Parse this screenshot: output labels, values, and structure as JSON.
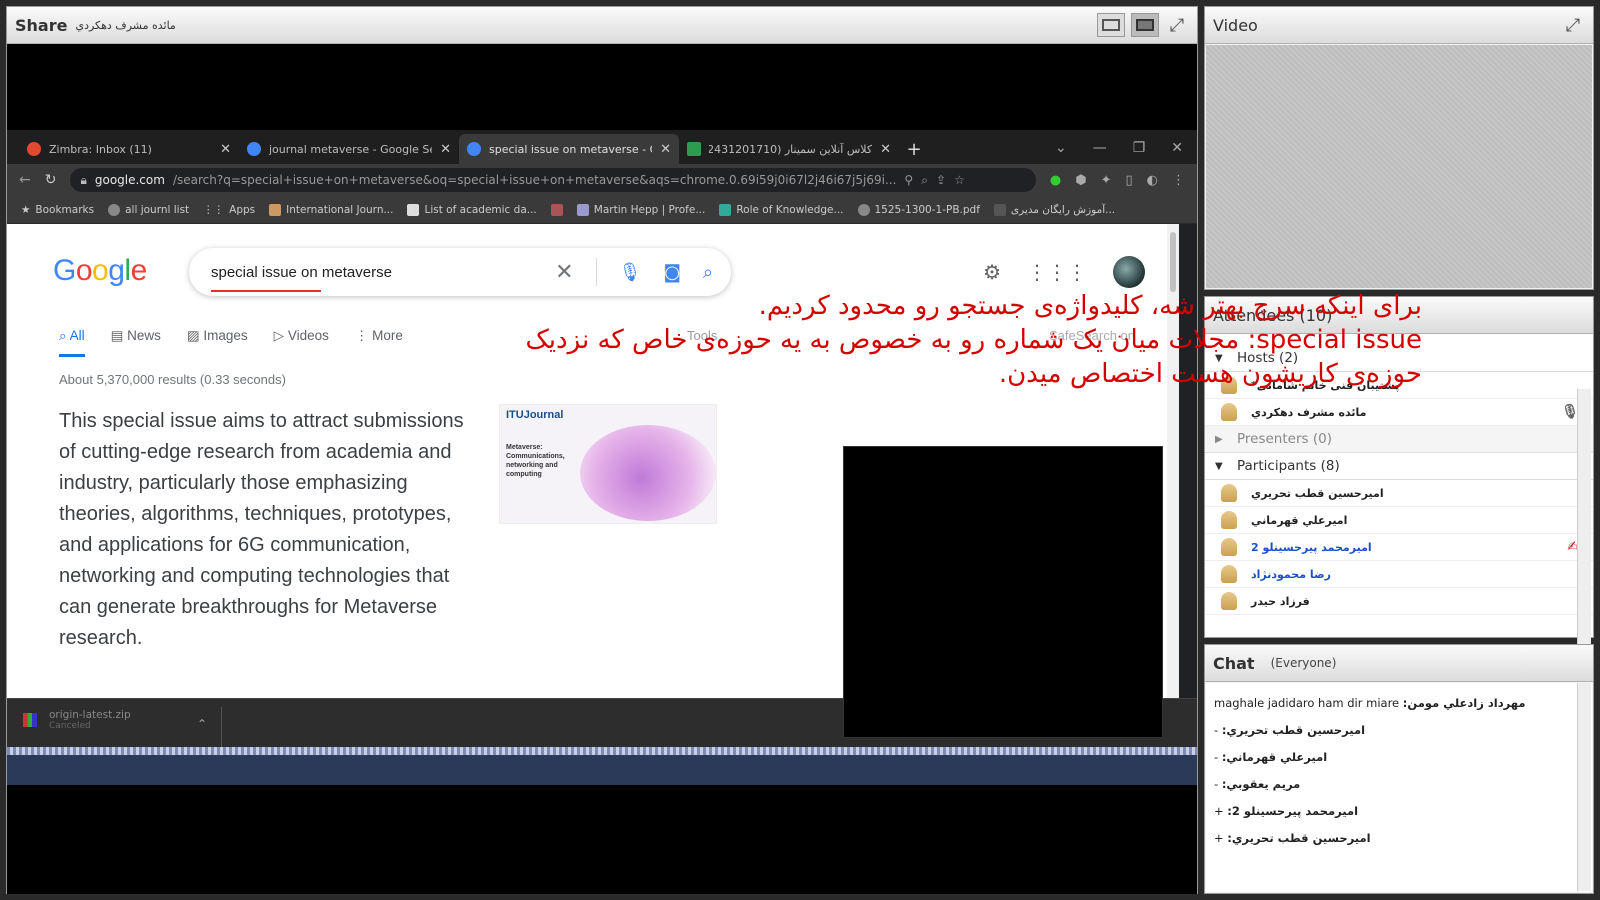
{
  "share": {
    "title": "Share",
    "presenter": "مائده مشرف دهکردي"
  },
  "browser": {
    "tabs": [
      {
        "label": "Zimbra: Inbox (11)",
        "favicon_color": "#e04a2f",
        "active": false
      },
      {
        "label": "journal metaverse - Google Sear",
        "favicon_color": "#4285f4",
        "active": false
      },
      {
        "label": "special issue on metaverse - Goo",
        "favicon_color": "#4285f4",
        "active": true
      },
      {
        "label": "کلاس آنلاین سمینار (12431201710",
        "favicon_color": "#2e9b4e",
        "active": false
      }
    ],
    "url_main": "google.com",
    "url_rest": "/search?q=special+issue+on+metaverse&oq=special+issue+on+metaverse&aqs=chrome.0.69i59j0i67l2j46i67j5j69i...",
    "bookmarks": [
      "Bookmarks",
      "all journl list",
      "Apps",
      "International Journ...",
      "List of academic da...",
      "",
      "Martin Hepp | Profe...",
      "Role of Knowledge...",
      "1525-1300-1-PB.pdf",
      "...آموزش رایگان مدیری"
    ]
  },
  "google": {
    "query": "special issue on metaverse",
    "tabs": [
      "All",
      "News",
      "Images",
      "Videos",
      "More"
    ],
    "tools_label": "Tools",
    "safesearch_label": "SafeSearch on",
    "result_stats": "About 5,370,000 results (0.33 seconds)",
    "snippet": "This special issue aims to attract submissions of cutting-edge research from academia and industry, particularly those emphasizing theories, algorithms, techniques, prototypes, and applications for 6G communication, networking and computing technologies that can generate breakthroughs for Metaverse research.",
    "thumb_title": "ITUJournal",
    "thumb_caption": "Metaverse: Communications, networking and computing"
  },
  "downloads": {
    "filename": "origin-latest.zip",
    "status": "Canceled"
  },
  "annotation": {
    "line1": "برای اینکه سرچ بهتر شه، کلیدواژه‌ی جستجو رو محدود کردیم.",
    "line2": "special issue: مجلات میان یک شماره رو به خصوص به یه حوزه‌ی خاص که نزدیک",
    "line3": "حوزه‌ی کاریشون هست اختصاص میدن."
  },
  "video": {
    "title": "Video"
  },
  "attendees": {
    "title": "Attendees (10)",
    "groups": {
      "hosts_label": "Hosts (2)",
      "presenters_label": "Presenters (0)",
      "participants_label": "Participants (8)"
    },
    "hosts": [
      "پشتیبان فنی خانم شامانی*",
      "مائده مشرف دهکردي"
    ],
    "participants": [
      {
        "name": "اميرحسين قطب تحريري",
        "blue": false
      },
      {
        "name": "اميرعلي قهرماني",
        "blue": false
      },
      {
        "name": "اميرمحمد پيرحسينلو 2",
        "blue": true
      },
      {
        "name": "رضا محمودنژاد",
        "blue": true
      },
      {
        "name": "فرزاد حیدر",
        "blue": false
      }
    ]
  },
  "chat": {
    "title": "Chat",
    "scope": "(Everyone)",
    "messages": [
      {
        "sender": "مهرداد زادعلي مومن:",
        "text": " maghale jadidaro ham dir miare"
      },
      {
        "sender": "اميرحسين قطب تحريري:",
        "text": " -"
      },
      {
        "sender": "اميرعلي قهرماني:",
        "text": " -"
      },
      {
        "sender": "مريم يعقوبي:",
        "text": " -"
      },
      {
        "sender": "اميرمحمد پيرحسينلو 2:",
        "text": " +"
      },
      {
        "sender": "اميرحسين قطب تحريري:",
        "text": " +"
      }
    ]
  }
}
